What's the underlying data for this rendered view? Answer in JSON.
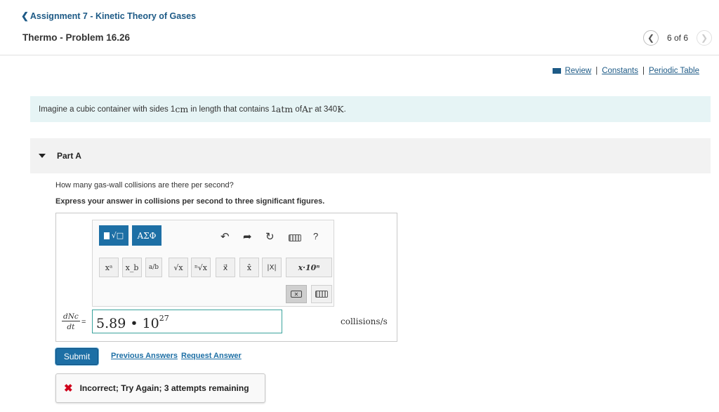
{
  "header": {
    "back_label": "Assignment 7 - Kinetic Theory of Gases",
    "problem_title": "Thermo - Problem 16.26",
    "pager": {
      "text": "6 of 6",
      "prev_icon": "chevron-left",
      "next_icon": "chevron-right"
    }
  },
  "tools": {
    "review": "Review",
    "constants": "Constants",
    "periodic_table": "Periodic Table",
    "separator": "|"
  },
  "intro": {
    "text_a": "Imagine a cubic container with sides 1 ",
    "unit_cm": "cm",
    "text_b": " in length that contains 1 ",
    "unit_atm": "atm",
    "text_c": " of ",
    "element": "Ar",
    "text_d": " at 340 ",
    "unit_k": "K",
    "text_e": "."
  },
  "part": {
    "label": "Part A"
  },
  "question": "How many gas-wall collisions are there per second?",
  "instruction": "Express your answer in collisions per second to three significant figures.",
  "toolbar": {
    "templates": "√□",
    "greek": "ΑΣΦ",
    "help": "?",
    "row2": [
      "xᵃ",
      "x_b",
      "a/b",
      "√x",
      "ⁿ√x",
      "x⃗",
      "x̂",
      "|X|",
      "x·10ⁿ"
    ]
  },
  "equation": {
    "lhs_num": "dNc",
    "lhs_den": "dt",
    "equals": "=",
    "answer_mantissa": "5.89 • 10",
    "answer_exponent": "27",
    "units": "collisions/s"
  },
  "actions": {
    "submit": "Submit",
    "previous_answers": "Previous Answers",
    "request_answer": "Request Answer"
  },
  "feedback": {
    "icon": "✖",
    "message": "Incorrect; Try Again; 3 attempts remaining"
  },
  "colors": {
    "accent": "#1d6fa5",
    "intro_bg": "#e6f4f5",
    "error": "#d0021b",
    "input_border": "#3aa39c"
  }
}
